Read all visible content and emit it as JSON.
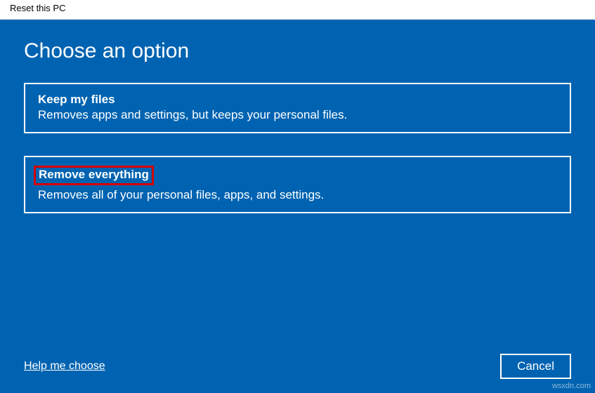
{
  "window": {
    "title": "Reset this PC"
  },
  "heading": "Choose an option",
  "options": [
    {
      "title": "Keep my files",
      "description": "Removes apps and settings, but keeps your personal files."
    },
    {
      "title": "Remove everything",
      "description": "Removes all of your personal files, apps, and settings."
    }
  ],
  "footer": {
    "help_link": "Help me choose",
    "cancel_label": "Cancel"
  },
  "watermark": "wsxdn.com"
}
